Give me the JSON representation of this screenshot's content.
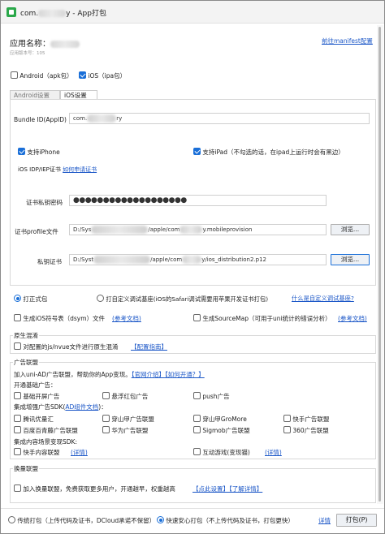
{
  "window": {
    "title_prefix": "com.",
    "title_suffix": "y - App打包"
  },
  "header": {
    "app_name_label": "应用名称：",
    "version_label": "应用版本号：",
    "version_value": "105",
    "manifest_link": "前往manifest配置"
  },
  "platforms": {
    "android": "Android（apk包）",
    "ios": "iOS（ipa包）"
  },
  "tabs": {
    "android": "Android设置",
    "ios": "iOS设置"
  },
  "ios": {
    "bundle_label": "Bundle ID(AppID)",
    "bundle_prefix": "com.",
    "bundle_suffix": "ry",
    "support_iphone": "支持iPhone",
    "support_ipad": "支持iPad（不勾选的话，在ipad上运行时会有黑边）",
    "cert_title": "iOS IDP/IEP证书",
    "cert_link": "如何申请证书",
    "password_label": "证书私钥密码",
    "password_value": "●●●●●●●●●●●●●●●●●●●",
    "profile_label": "证书profile文件",
    "profile_prefix": "D:/Sys",
    "profile_mid": "/apple/com",
    "profile_suffix": "y.mobileprovision",
    "browse1": "浏览...",
    "cert_label": "私钥证书",
    "cert_prefix": "D:/Syst",
    "cert_mid": "/apple/com",
    "cert_suffix": "y/ios_distribution2.p12",
    "browse2": "浏览..."
  },
  "pack": {
    "formal": "打正式包",
    "custom": "打自定义调试基座(iOS的Safari调试需要用苹果开发证书打包)",
    "custom_link": "什么是自定义调试基座?"
  },
  "options": {
    "dsym": "生成iOS符号表（dsym）文件",
    "dsym_link": "(参考文档)",
    "sourcemap": "生成SourceMap（可用于uni统计的错误分析）",
    "sourcemap_link": "(参考文档)"
  },
  "obfuscate": {
    "title": "原生混淆",
    "option": "对配置的js/nvue文件进行原生混淆",
    "link": "【配置指南】"
  },
  "ads": {
    "title": "广告联盟",
    "intro": "加入uni-AD广告联盟，帮助你的App变现。",
    "intro_link1": "【官网介绍】",
    "intro_link2": "【如何开通？】",
    "basic_title": "开通基础广告：",
    "basic": [
      "基础开屏广告",
      "悬浮红包广告",
      "push广告"
    ],
    "enhanced_title_pre": "集成增强广告SDK(",
    "enhanced_link": "AD组件文档",
    "enhanced_title_post": ")：",
    "enhanced_row1": [
      "腾讯优量汇",
      "穿山甲广告联盟",
      "穿山甲GroMore",
      "快手广告联盟"
    ],
    "enhanced_row2": [
      "百度百青藤广告联盟",
      "华为广告联盟",
      "Sigmob广告联盟",
      "360广告联盟"
    ],
    "content_title": "集成内容场景变现SDK:",
    "content1": "快手内容联盟",
    "content1_link": "(详情)",
    "content2": "互动游戏(变现猫)",
    "content2_link": "(详情)"
  },
  "exchange": {
    "title": "换量联盟",
    "option": "加入换量联盟，免费获取更多用户，开通越早，权重越高",
    "link1": "【点此设置】",
    "link2": "【了解详情】"
  },
  "footer": {
    "traditional": "传统打包（上传代码及证书，DCloud承诺不保留）",
    "fast": "快速安心打包（不上传代码及证书，打包更快）",
    "details_link": "详情",
    "pack_button": "打包(P)"
  }
}
